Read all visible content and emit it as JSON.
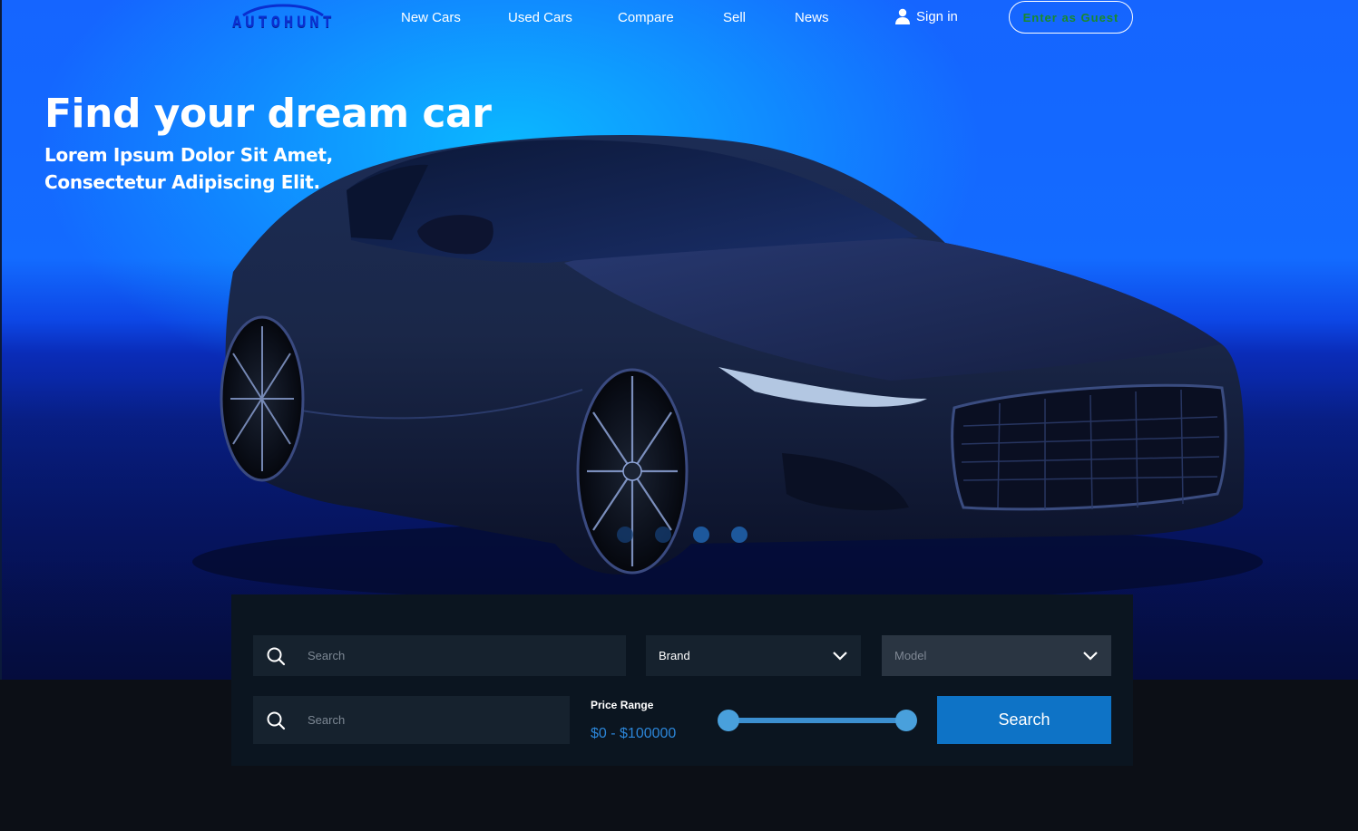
{
  "nav": {
    "logo_text": "AUTOHUNT",
    "links": [
      "New Cars",
      "Used Cars",
      "Compare",
      "Sell",
      "News"
    ],
    "sign_in": "Sign in",
    "guest_button": "Enter as Guest"
  },
  "hero": {
    "title": "Find your dream car",
    "subtitle_line1": "Lorem Ipsum Dolor Sit Amet,",
    "subtitle_line2": "Consectetur Adipiscing Elit.",
    "carousel_count": 4
  },
  "search": {
    "search_placeholder_1": "Search",
    "brand_label": "Brand",
    "model_label": "Model",
    "search_placeholder_2": "Search",
    "price_range_label": "Price Range",
    "price_range_value": "$0 - $100000",
    "price_min": 0,
    "price_max": 100000,
    "search_button": "Search"
  },
  "colors": {
    "accent": "#0e73c6",
    "price_text": "#2c86d9",
    "guest_text": "#1a8a2a",
    "panel_bg": "#0b1520"
  },
  "icons": [
    "user-icon",
    "search-icon",
    "chevron-down-icon",
    "car-logo-icon"
  ]
}
